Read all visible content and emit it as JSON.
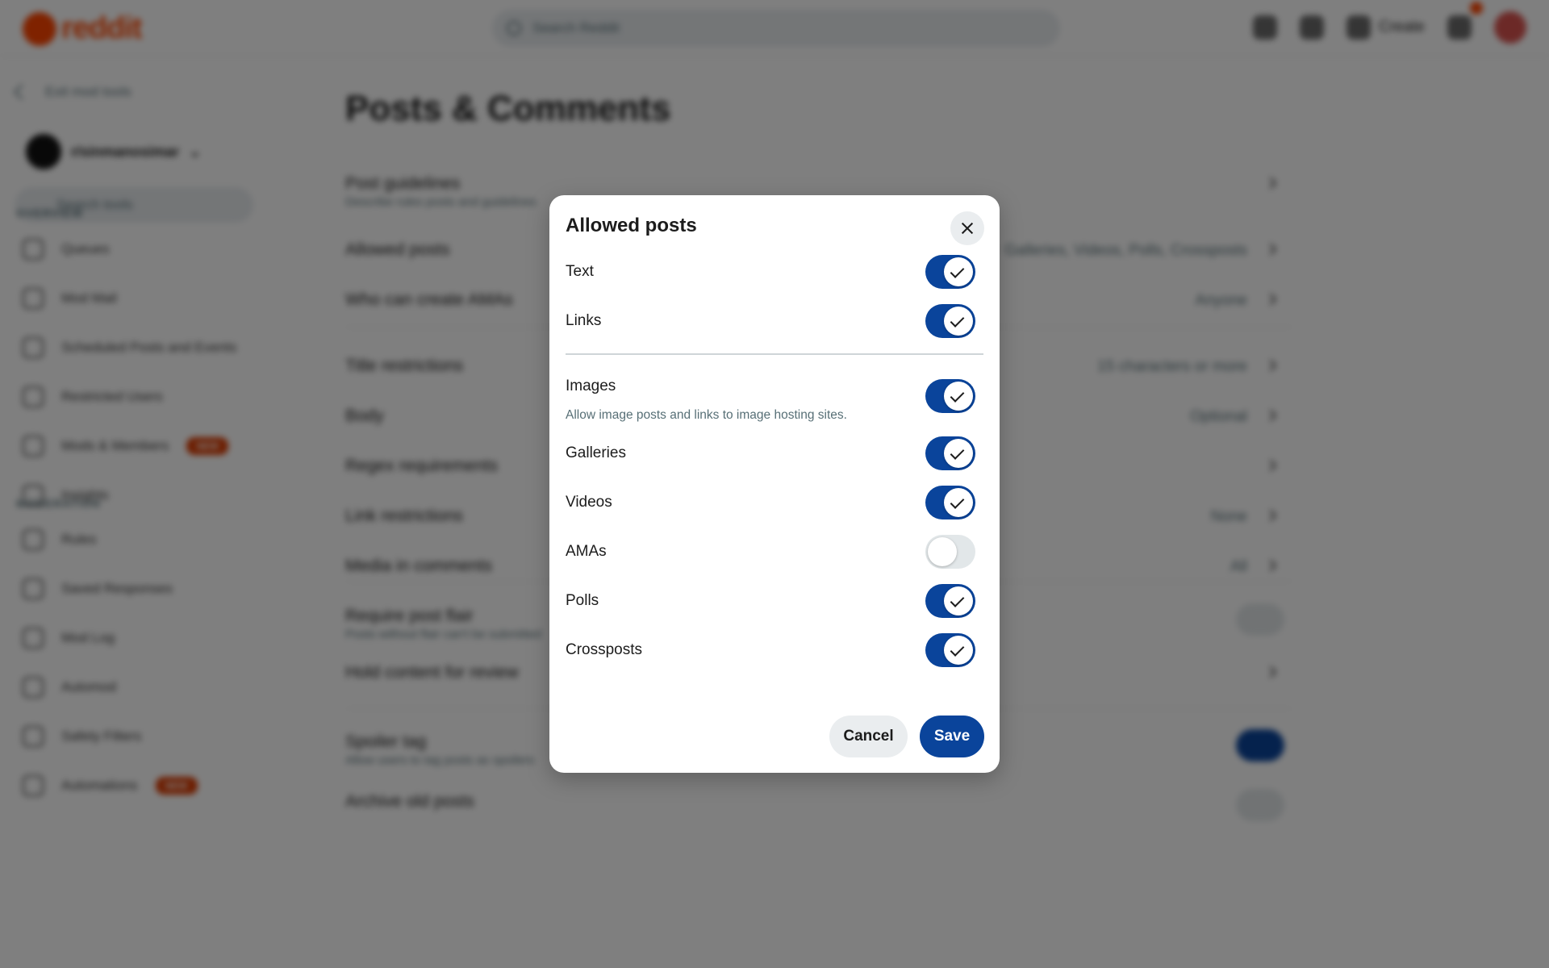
{
  "background": {
    "brand": "reddit",
    "search_placeholder": "Search Reddit",
    "create_label": "Create",
    "back_label": "Exit mod tools",
    "community_name": "r/sinmanosimar",
    "tool_search_placeholder": "Search tools",
    "sections": [
      {
        "title": "OVERVIEW",
        "items": [
          {
            "label": "Queues",
            "badge": ""
          },
          {
            "label": "Mod Mail",
            "badge": ""
          },
          {
            "label": "Scheduled Posts and Events",
            "badge": ""
          },
          {
            "label": "Restricted Users",
            "badge": ""
          },
          {
            "label": "Mods & Members",
            "badge": "NEW"
          },
          {
            "label": "Insights",
            "badge": ""
          }
        ]
      },
      {
        "title": "MODERATION",
        "items": [
          {
            "label": "Rules",
            "badge": ""
          },
          {
            "label": "Saved Responses",
            "badge": ""
          },
          {
            "label": "Mod Log",
            "badge": ""
          },
          {
            "label": "Automod",
            "badge": ""
          },
          {
            "label": "Safety Filters",
            "badge": ""
          },
          {
            "label": "Automations",
            "badge": "NEW"
          }
        ]
      }
    ],
    "page_title": "Posts & Comments",
    "settings": [
      {
        "label": "Post guidelines",
        "sub": "Describe rules posts and guidelines",
        "value": "",
        "control": "chevron"
      },
      {
        "label": "Allowed posts",
        "sub": "",
        "value": "Galleries, Videos, Polls, Crossposts",
        "control": "chevron"
      },
      {
        "label": "Who can create AMAs",
        "sub": "",
        "value": "Anyone",
        "control": "chevron"
      },
      {
        "label": "Title restrictions",
        "sub": "",
        "value": "15 characters or more",
        "control": "chevron"
      },
      {
        "label": "Body",
        "sub": "",
        "value": "Optional",
        "control": "chevron"
      },
      {
        "label": "Regex requirements",
        "sub": "",
        "value": "",
        "control": "chevron"
      },
      {
        "label": "Link restrictions",
        "sub": "",
        "value": "None",
        "control": "chevron"
      },
      {
        "label": "Media in comments",
        "sub": "",
        "value": "All",
        "control": "chevron"
      },
      {
        "label": "Require post flair",
        "sub": "Posts without flair can't be submitted",
        "value": "",
        "control": "toggle-off"
      },
      {
        "label": "Hold content for review",
        "sub": "",
        "value": "",
        "control": "chevron"
      },
      {
        "label": "Spoiler tag",
        "sub": "Allow users to tag posts as spoilers",
        "value": "",
        "control": "toggle-on"
      },
      {
        "label": "Archive old posts",
        "sub": "",
        "value": "",
        "control": "toggle-off"
      }
    ]
  },
  "modal": {
    "title": "Allowed posts",
    "options": [
      {
        "label": "Text",
        "sub": "",
        "enabled": true
      },
      {
        "label": "Links",
        "sub": "",
        "enabled": true
      },
      {
        "label": "Images",
        "sub": "Allow image posts and links to image hosting sites.",
        "enabled": true
      },
      {
        "label": "Galleries",
        "sub": "",
        "enabled": true
      },
      {
        "label": "Videos",
        "sub": "",
        "enabled": true
      },
      {
        "label": "AMAs",
        "sub": "",
        "enabled": false
      },
      {
        "label": "Polls",
        "sub": "",
        "enabled": true
      },
      {
        "label": "Crossposts",
        "sub": "",
        "enabled": true
      }
    ],
    "cancel_label": "Cancel",
    "save_label": "Save"
  },
  "colors": {
    "accent": "#0a449b",
    "toggle_off": "#e2e7e9",
    "overlay": "rgba(0,0,0,0.5)",
    "brand": "#ff4500"
  }
}
